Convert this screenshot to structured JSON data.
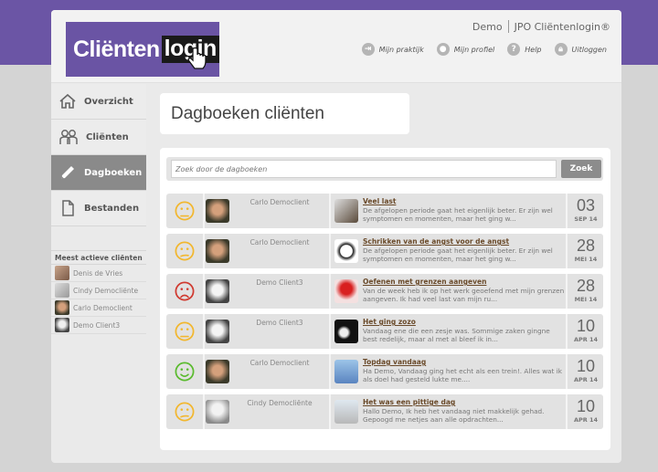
{
  "colors": {
    "brand": "#6b55a5",
    "face_neutral": "#f2b72f",
    "face_sad": "#d03a30",
    "face_happy": "#5bbb2f"
  },
  "logo": {
    "part1": "Cliënten",
    "part2": "login"
  },
  "header": {
    "user": "Demo",
    "brand": "JPO Cliëntenlogin®",
    "nav": [
      {
        "label": "Mijn praktijk",
        "icon": "practice-icon"
      },
      {
        "label": "Mijn profiel",
        "icon": "user-icon"
      },
      {
        "label": "Help",
        "icon": "help-icon"
      },
      {
        "label": "Uitloggen",
        "icon": "lock-icon"
      }
    ]
  },
  "sidebar": {
    "items": [
      {
        "label": "Overzicht",
        "icon": "home-icon"
      },
      {
        "label": "Cliënten",
        "icon": "users-icon"
      },
      {
        "label": "Dagboeken",
        "icon": "pencil-icon"
      },
      {
        "label": "Bestanden",
        "icon": "document-icon"
      }
    ],
    "active_title": "Meest actieve cliënten",
    "active_clients": [
      "Denis de Vries",
      "Cindy Democliënte",
      "Carlo Democlient",
      "Demo Client3"
    ]
  },
  "page": {
    "title": "Dagboeken cliënten"
  },
  "search": {
    "placeholder": "Zoek door de dagboeken",
    "button": "Zoek"
  },
  "entries": [
    {
      "mood": "neutral",
      "client": "Carlo Democlient",
      "title": "Veel last",
      "excerpt": "De afgelopen periode gaat het eigenlijk beter. Er zijn wel symptomen en momenten, maar het ging w...",
      "day": "03",
      "month": "SEP 14"
    },
    {
      "mood": "neutral",
      "client": "Carlo Democlient",
      "title": "Schrikken van de angst voor de angst",
      "excerpt": "De afgelopen periode gaat het eigenlijk beter. Er zijn wel symptomen en momenten, maar het ging w...",
      "day": "28",
      "month": "MEI 14"
    },
    {
      "mood": "sad",
      "client": "Demo Client3",
      "title": "Oefenen met grenzen aangeven",
      "excerpt": "Van de week heb ik op het werk geoefend met mijn grenzen aangeven. Ik had veel last van mijn ru...",
      "day": "28",
      "month": "MEI 14"
    },
    {
      "mood": "neutral",
      "client": "Demo Client3",
      "title": "Het ging zozo",
      "excerpt": "Vandaag ene die een zesje was. Sommige zaken gingne best redelijk, maar al met al bleef ik in...",
      "day": "10",
      "month": "APR 14"
    },
    {
      "mood": "happy",
      "client": "Carlo Democlient",
      "title": "Topdag vandaag",
      "excerpt": "Ha Demo, Vandaag ging het echt als een trein!. Alles wat ik als doel had gesteld lukte me....",
      "day": "10",
      "month": "APR 14"
    },
    {
      "mood": "neutral",
      "client": "Cindy Democliënte",
      "title": "Het was een pittige dag",
      "excerpt": "Hallo Demo, Ik heb het vandaag niet makkelijk gehad. Gepoogd me netjes aan alle opdrachten...",
      "day": "10",
      "month": "APR 14"
    }
  ]
}
